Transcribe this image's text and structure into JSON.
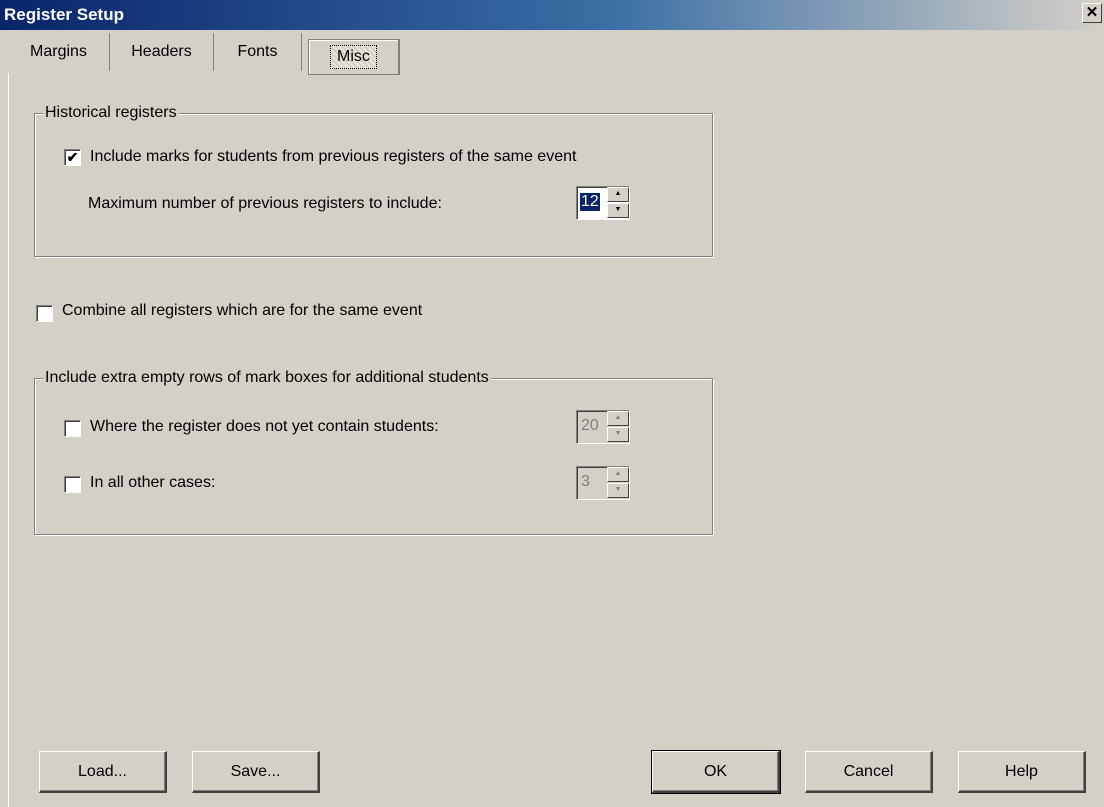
{
  "window": {
    "title": "Register Setup",
    "close_glyph": "✕"
  },
  "tabs": [
    {
      "label": "Margins"
    },
    {
      "label": "Headers"
    },
    {
      "label": "Fonts"
    },
    {
      "label": "Misc",
      "active": true
    }
  ],
  "historical": {
    "legend": "Historical registers",
    "include_marks_label": "Include marks for students from previous registers of the same event",
    "include_marks_checked": true,
    "max_previous_label": "Maximum number of previous registers to include:",
    "max_previous_value": "12"
  },
  "combine": {
    "label": "Combine all registers which are for the same event",
    "checked": false
  },
  "extra_rows": {
    "legend": "Include extra empty rows of mark boxes for additional students",
    "no_students_label": "Where the register does not yet contain students:",
    "no_students_checked": false,
    "no_students_value": "20",
    "other_cases_label": "In all other cases:",
    "other_cases_checked": false,
    "other_cases_value": "3"
  },
  "buttons": {
    "load": "Load...",
    "save": "Save...",
    "ok": "OK",
    "cancel": "Cancel",
    "help": "Help"
  },
  "icons": {
    "spin_up": "▲",
    "spin_down": "▼",
    "check": "✔"
  }
}
